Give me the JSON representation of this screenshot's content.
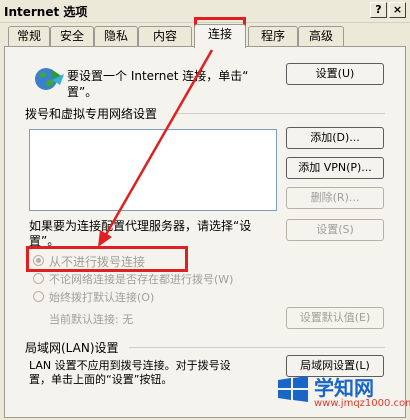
{
  "window": {
    "title": "Internet 选项",
    "help_label": "?",
    "close_label": "×"
  },
  "tabs": [
    {
      "label": "常规"
    },
    {
      "label": "安全"
    },
    {
      "label": "隐私"
    },
    {
      "label": "内容"
    },
    {
      "label": "连接"
    },
    {
      "label": "程序"
    },
    {
      "label": "高级"
    }
  ],
  "active_tab": "连接",
  "setup": {
    "text_line1": "要设置一个 Internet 连接，单击“",
    "text_line2": "置”。",
    "button": "设置(U)"
  },
  "dialup": {
    "group_title": "拨号和虚拟专用网络设置",
    "add_button": "添加(D)...",
    "add_vpn_button": "添加 VPN(P)...",
    "delete_button": "删除(R)...",
    "settings_button": "设置(S)",
    "proxy_text_line1": "如果要为连接配置代理服务器，请选择“设",
    "proxy_text_line2": "置”。",
    "radio_never": "从不进行拨号连接",
    "radio_when_no_net": "不论网络连接是否存在都进行拨号(W)",
    "radio_always": "始终拨打默认连接(O)",
    "current_default": "当前默认连接: 无",
    "set_default_button": "设置默认值(E)"
  },
  "lan": {
    "group_title": "局域网(LAN)设置",
    "text_line1": "LAN 设置不应用到拨号连接。对于拨号设",
    "text_line2": "置，单击上面的“设置”按钮。",
    "button": "局域网设置(L)"
  },
  "watermark": {
    "brand": "学知网",
    "site": "www.jmqz1000.com"
  },
  "colors": {
    "highlight": "#e02020",
    "watermark_blue": "#1a66c8",
    "watermark_red": "#e03a2a"
  }
}
